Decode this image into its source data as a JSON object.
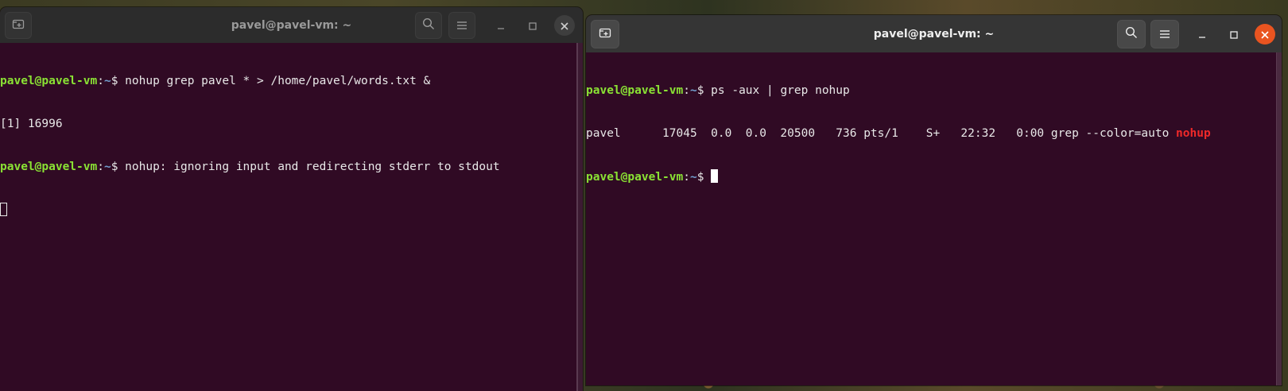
{
  "left_window": {
    "title": "pavel@pavel-vm: ~",
    "icons": {
      "new_tab": "new-tab-icon",
      "search": "search-icon",
      "menu": "hamburger-menu-icon",
      "minimize": "minimize-icon",
      "maximize": "maximize-icon",
      "close": "close-icon"
    },
    "lines": [
      {
        "user": "pavel@pavel-vm",
        "sep": ":",
        "path": "~",
        "prompt_end": "$ ",
        "text": "nohup grep pavel * > /home/pavel/words.txt &"
      },
      {
        "text": "[1] 16996"
      },
      {
        "user": "pavel@pavel-vm",
        "sep": ":",
        "path": "~",
        "prompt_end": "$ ",
        "text": "nohup: ignoring input and redirecting stderr to stdout"
      }
    ]
  },
  "right_window": {
    "title": "pavel@pavel-vm: ~",
    "icons": {
      "new_tab": "new-tab-icon",
      "search": "search-icon",
      "menu": "hamburger-menu-icon",
      "minimize": "minimize-icon",
      "maximize": "maximize-icon",
      "close": "close-icon"
    },
    "lines": [
      {
        "user": "pavel@pavel-vm",
        "sep": ":",
        "path": "~",
        "prompt_end": "$ ",
        "text": "ps -aux | grep nohup"
      },
      {
        "text": "pavel      17045  0.0  0.0  20500   736 pts/1    S+   22:32   0:00 grep --color=auto ",
        "highlight": "nohup"
      },
      {
        "user": "pavel@pavel-vm",
        "sep": ":",
        "path": "~",
        "prompt_end": "$ "
      }
    ]
  },
  "colors": {
    "terminal_bg": "#300a24",
    "prompt_user": "#8ae234",
    "prompt_path": "#729fcf",
    "grep_match": "#ef2929",
    "close_button_active": "#e95420"
  }
}
